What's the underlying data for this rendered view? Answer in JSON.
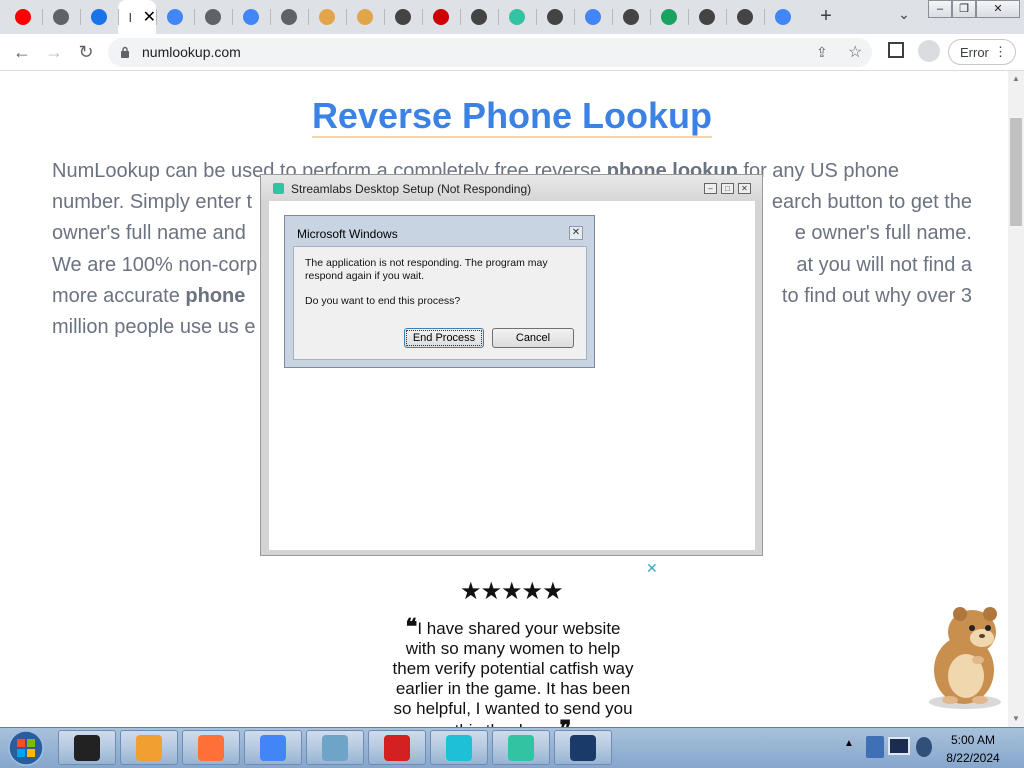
{
  "browser": {
    "tabs": [
      {
        "icon": "youtube-icon",
        "color": "#ff0000"
      },
      {
        "icon": "globe-icon",
        "color": "#5f6368"
      },
      {
        "icon": "history-icon",
        "color": "#1a73e8"
      },
      {
        "icon": "active-tab",
        "color": "#5f6368",
        "active": true
      },
      {
        "icon": "google-icon",
        "color": "#4285f4"
      },
      {
        "icon": "globe-icon",
        "color": "#5f6368"
      },
      {
        "icon": "google-icon",
        "color": "#4285f4"
      },
      {
        "icon": "globe-icon",
        "color": "#5f6368"
      },
      {
        "icon": "chart-icon",
        "color": "#e3a54a"
      },
      {
        "icon": "chart-icon",
        "color": "#e3a54a"
      },
      {
        "icon": "chrome-icon",
        "color": "#444444"
      },
      {
        "icon": "record-icon",
        "color": "#cc0000"
      },
      {
        "icon": "chrome-icon",
        "color": "#444444"
      },
      {
        "icon": "streamlabs-icon",
        "color": "#31c3a2"
      },
      {
        "icon": "chrome-icon",
        "color": "#444444"
      },
      {
        "icon": "google-icon",
        "color": "#4285f4"
      },
      {
        "icon": "chrome-icon",
        "color": "#444444"
      },
      {
        "icon": "dollar-icon",
        "color": "#1aa260"
      },
      {
        "icon": "chrome-icon",
        "color": "#444444"
      },
      {
        "icon": "chrome-icon",
        "color": "#444444"
      },
      {
        "icon": "google-icon",
        "color": "#4285f4"
      }
    ],
    "active_tab_title": "I",
    "new_tab_label": "+",
    "url": "numlookup.com",
    "error_label": "Error"
  },
  "page": {
    "title": "Reverse Phone Lookup",
    "intro_lines": [
      "NumLookup can be used to perform a completely free reverse phone lookup for any US phone",
      "number. Simply enter the ... earch button to get the",
      "owner's full name and ... e owner's full name.",
      "We are 100% non-corp ... at you will not find a",
      "more accurate phone ... to find out why over 3",
      "million people use us e"
    ],
    "intro": {
      "l1a": "NumLookup can be used to perform a completely free reverse ",
      "l1b": "phone lookup",
      "l1c": " for any US phone",
      "l2a": "number. Simply enter t",
      "l2b": "earch button to get the",
      "l3a": "owner's full name and",
      "l3b": "e owner's full name.",
      "l4a": "We are 100% non-corp",
      "l4b": "at you will not find a",
      "l5a": "more accurate ",
      "l5b": "phone",
      "l5c": "to find out why over 3",
      "l6a": "million people use us e"
    },
    "stars": "★★★★★",
    "testimonial": "I have shared your website with so many women to help them verify potential catfish way earlier in the game.  It has been so helpful, I wanted to send you this thank you",
    "ad_close": "✕"
  },
  "not_responding_window": {
    "title": "Streamlabs Desktop Setup  (Not Responding)"
  },
  "dialog": {
    "title": "Microsoft Windows",
    "message": "The application is not responding. The program may respond again if you wait.",
    "question": "Do you want to end this process?",
    "end_process_label": "End Process",
    "cancel_label": "Cancel"
  },
  "taskbar": {
    "apps": [
      {
        "name": "taskbar-app-black",
        "color": "#222222"
      },
      {
        "name": "taskbar-app-media",
        "color": "#f0a030"
      },
      {
        "name": "taskbar-app-firefox",
        "color": "#ff7139"
      },
      {
        "name": "taskbar-app-chrome",
        "color": "#4285f4"
      },
      {
        "name": "taskbar-app-notes",
        "color": "#6fa4c9"
      },
      {
        "name": "taskbar-app-avira",
        "color": "#d42020"
      },
      {
        "name": "taskbar-app-gem",
        "color": "#1ec0d8"
      },
      {
        "name": "taskbar-app-streamlabs",
        "color": "#31c3a2"
      },
      {
        "name": "taskbar-app-display",
        "color": "#1a3a6a"
      }
    ],
    "time": "5:00 AM",
    "date": "8/22/2024"
  }
}
